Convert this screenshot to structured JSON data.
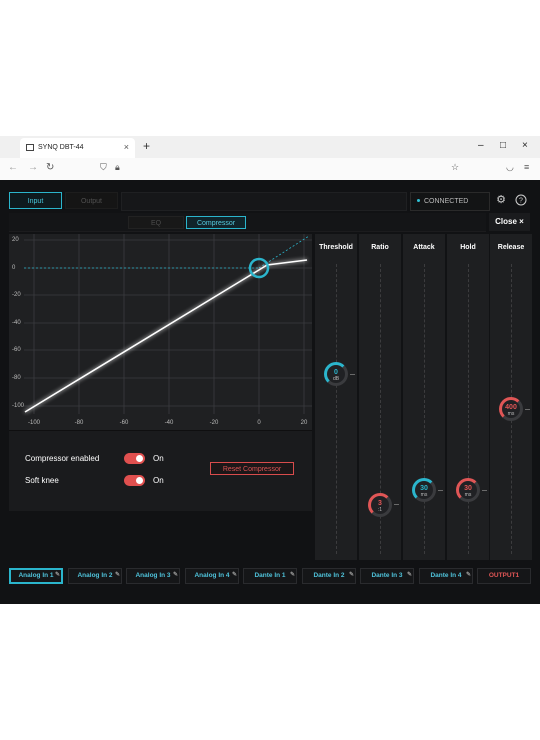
{
  "browser": {
    "tab_title": "SYNQ DBT-44",
    "tab_close": "×",
    "new_tab": "+",
    "window_controls": [
      "–",
      "□",
      "×"
    ],
    "nav_icons": [
      "arrow-back-icon",
      "arrow-forward-icon",
      "reload-icon",
      "shield-icon",
      "lock-icon",
      "star-icon",
      "pocket-icon",
      "menu-icon"
    ]
  },
  "app": {
    "top_tabs": [
      "Input",
      "Output"
    ],
    "status": "CONNECTED",
    "sub_tabs": [
      "EQ",
      "Compressor"
    ],
    "close_label": "Close ×",
    "accent_color": "#2bb5cc",
    "warning_color": "#e0504f"
  },
  "graph": {
    "y_labels": [
      "20",
      "0",
      "-20",
      "-40",
      "-60",
      "-80",
      "-100"
    ],
    "x_labels": [
      "-100",
      "-80",
      "-60",
      "-40",
      "-20",
      "0",
      "20"
    ],
    "threshold_marker_db": 0
  },
  "controls": {
    "compressor_label": "Compressor enabled",
    "compressor_state": "On",
    "softknee_label": "Soft knee",
    "softknee_state": "On",
    "reset_label": "Reset Compressor"
  },
  "faders": [
    {
      "title": "Threshold",
      "value": "0",
      "unit": "dB",
      "level": 0.62,
      "color": "#2bb5cc"
    },
    {
      "title": "Ratio",
      "value": "3",
      "unit": ":1",
      "level": 0.17,
      "color": "#e05656"
    },
    {
      "title": "Attack",
      "value": "30",
      "unit": "ms",
      "level": 0.22,
      "color": "#2bb5cc"
    },
    {
      "title": "Hold",
      "value": "30",
      "unit": "ms",
      "level": 0.22,
      "color": "#e05656"
    },
    {
      "title": "Release",
      "value": "400",
      "unit": "ms",
      "level": 0.5,
      "color": "#e05656"
    }
  ],
  "channels": [
    "Analog In 1",
    "Analog In 2",
    "Analog In 3",
    "Analog In 4",
    "Dante In 1",
    "Dante In 2",
    "Dante In 3",
    "Dante In 4",
    "OUTPUT1"
  ]
}
